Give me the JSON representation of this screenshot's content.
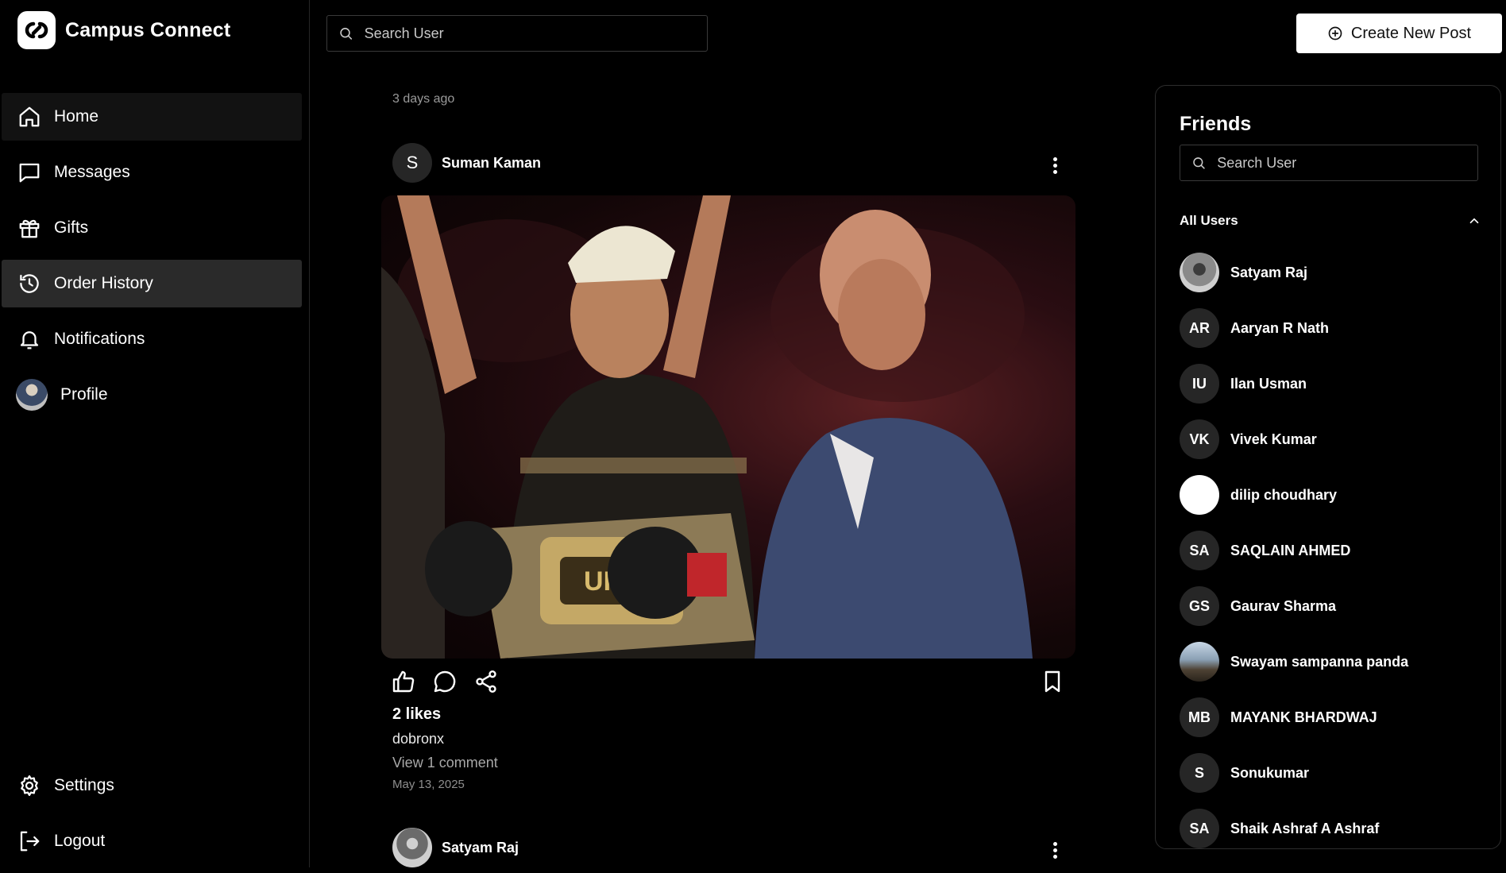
{
  "app": {
    "name": "Campus Connect"
  },
  "nav": {
    "items": [
      {
        "label": "Home",
        "icon": "home-icon"
      },
      {
        "label": "Messages",
        "icon": "message-icon"
      },
      {
        "label": "Gifts",
        "icon": "gift-icon"
      },
      {
        "label": "Order History",
        "icon": "history-icon"
      },
      {
        "label": "Notifications",
        "icon": "bell-icon"
      },
      {
        "label": "Profile",
        "icon": "avatar"
      }
    ],
    "bottom": [
      {
        "label": "Settings",
        "icon": "gear-icon"
      },
      {
        "label": "Logout",
        "icon": "logout-icon"
      }
    ]
  },
  "topbar": {
    "search_placeholder": "Search User",
    "create_label": "Create New Post"
  },
  "feed": {
    "timestamp": "3 days ago",
    "post": {
      "author_initial": "S",
      "author": "Suman Kaman",
      "likes": "2 likes",
      "caption": "dobronx",
      "view_comments": "View 1 comment",
      "date": "May 13, 2025"
    },
    "next_post": {
      "author": "Satyam Raj"
    }
  },
  "friends": {
    "title": "Friends",
    "search_placeholder": "Search User",
    "section_label": "All Users",
    "users": [
      {
        "name": "Satyam Raj",
        "initials": ""
      },
      {
        "name": "Aaryan R Nath",
        "initials": "AR"
      },
      {
        "name": "Ilan Usman",
        "initials": "IU"
      },
      {
        "name": "Vivek Kumar",
        "initials": "VK"
      },
      {
        "name": "dilip choudhary",
        "initials": ""
      },
      {
        "name": "SAQLAIN AHMED",
        "initials": "SA"
      },
      {
        "name": "Gaurav Sharma",
        "initials": "GS"
      },
      {
        "name": "Swayam sampanna panda",
        "initials": ""
      },
      {
        "name": "MAYANK BHARDWAJ",
        "initials": "MB"
      },
      {
        "name": "Sonukumar",
        "initials": "S"
      },
      {
        "name": "Shaik Ashraf A Ashraf",
        "initials": "SA"
      }
    ]
  },
  "colors": {
    "background": "#000000",
    "active_nav": "#2a2a2a",
    "muted_text": "#9a9a9a"
  }
}
